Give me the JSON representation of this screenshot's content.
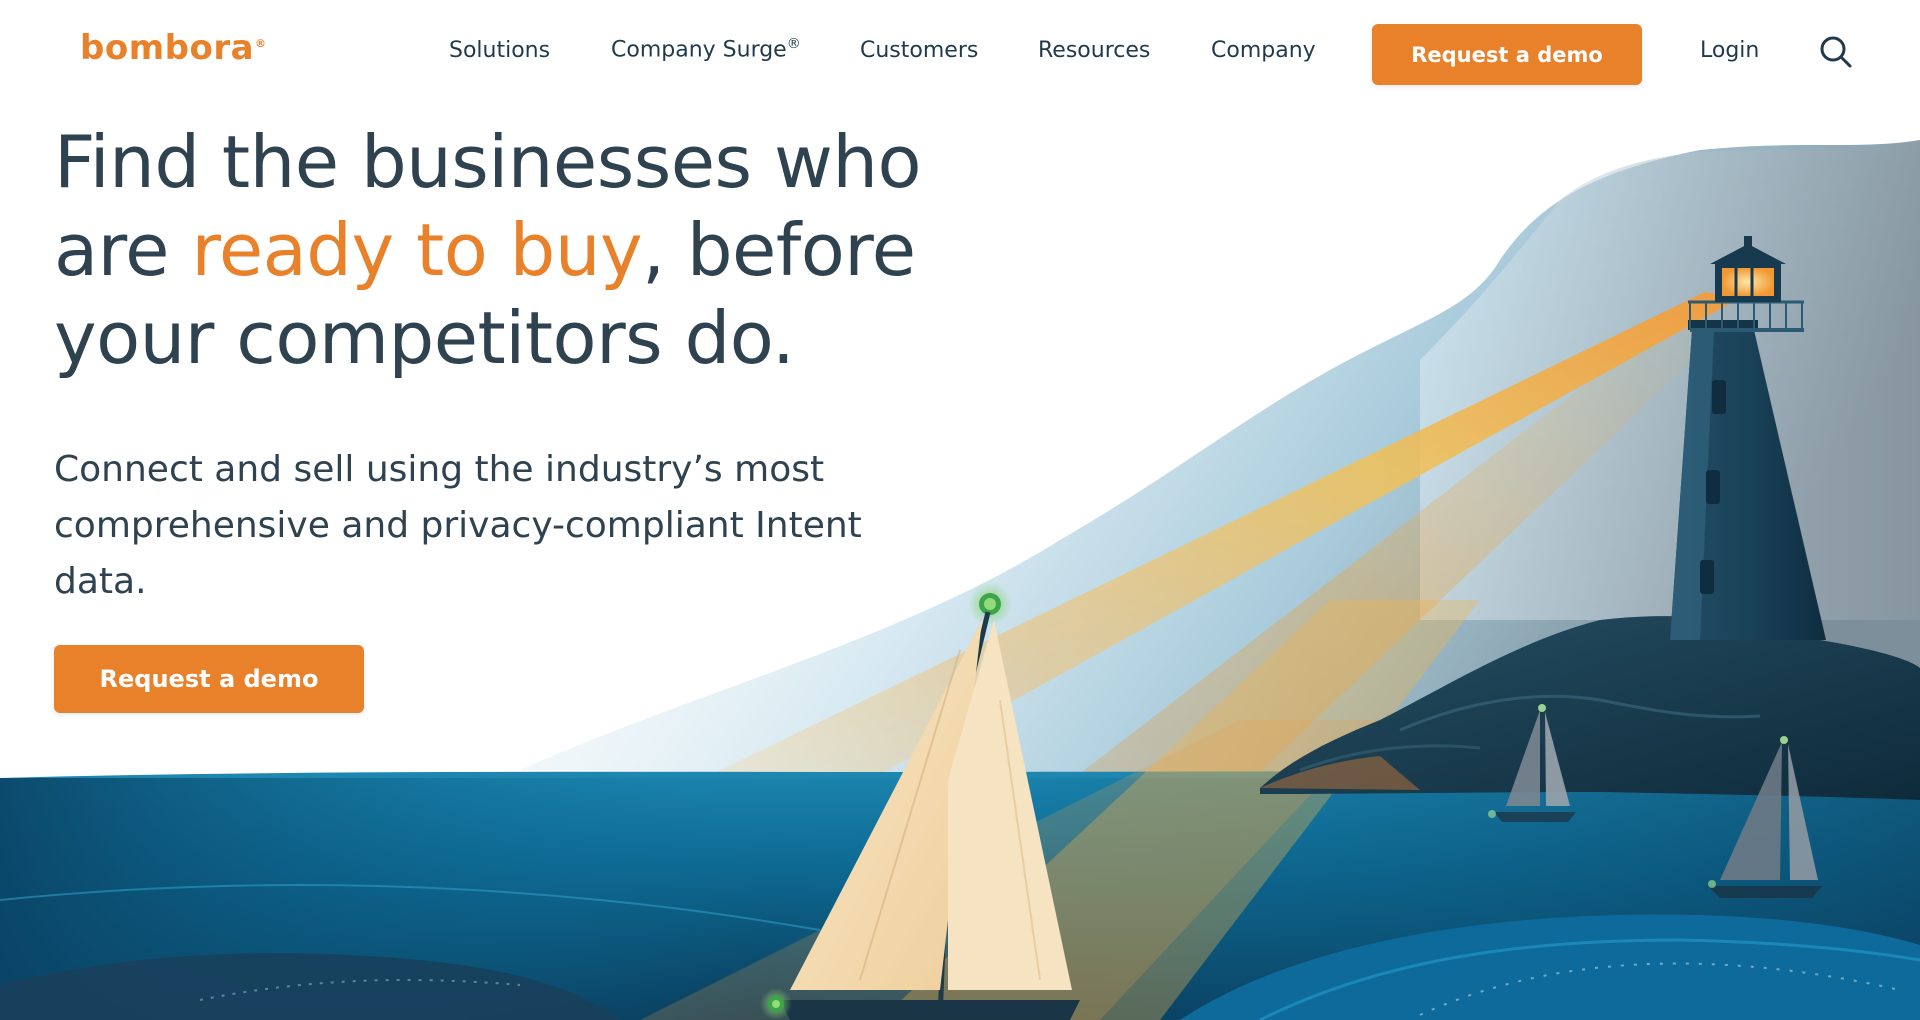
{
  "brand": {
    "logo_text": "bombora",
    "logo_mark": "®",
    "accent_color": "#e8812a",
    "text_color": "#2f424f",
    "nav_color": "#1f3a4d"
  },
  "nav": {
    "items": [
      {
        "label": "Solutions"
      },
      {
        "label": "Company Surge",
        "mark": "®"
      },
      {
        "label": "Customers"
      },
      {
        "label": "Resources"
      },
      {
        "label": "Company"
      }
    ],
    "cta_label": "Request a demo",
    "login_label": "Login",
    "search_icon": "search-icon"
  },
  "hero": {
    "title_part1": "Find the businesses who are ",
    "title_accent": "ready to buy",
    "title_part2": ", before your competitors do.",
    "subtitle": "Connect and sell using the industry’s most comprehensive and privacy-compliant Intent data.",
    "cta_label": "Request a demo"
  },
  "illustration": {
    "subject": "lighthouse beam illuminating a sailboat at sea",
    "palette": {
      "sea_dark": "#0b3b58",
      "sea_mid": "#0e6f99",
      "sky_blue": "#bcd9e6",
      "beam": "#f0b54a",
      "sail": "#f4dcb0",
      "lighthouse": "#173a4f"
    }
  }
}
